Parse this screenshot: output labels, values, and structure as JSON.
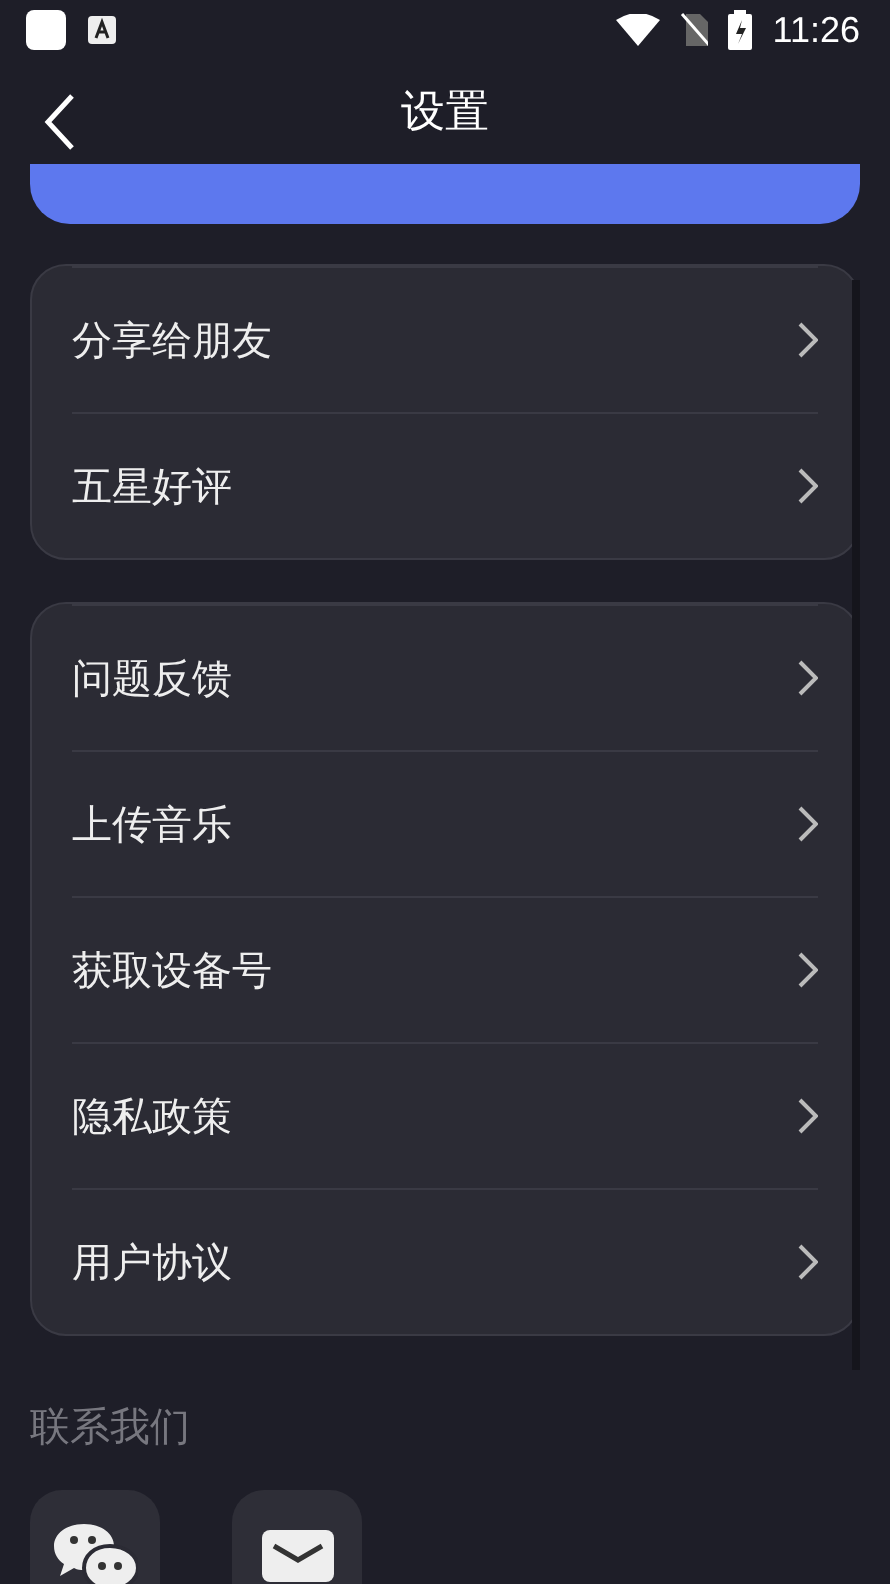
{
  "status_bar": {
    "time": "11:26"
  },
  "header": {
    "title": "设置"
  },
  "sections": [
    {
      "items": [
        "分享给朋友",
        "五星好评"
      ]
    },
    {
      "items": [
        "问题反馈",
        "上传音乐",
        "获取设备号",
        "隐私政策",
        "用户协议"
      ]
    }
  ],
  "contact": {
    "title": "联系我们",
    "buttons": [
      {
        "kind": "wechat"
      },
      {
        "kind": "email"
      }
    ]
  }
}
